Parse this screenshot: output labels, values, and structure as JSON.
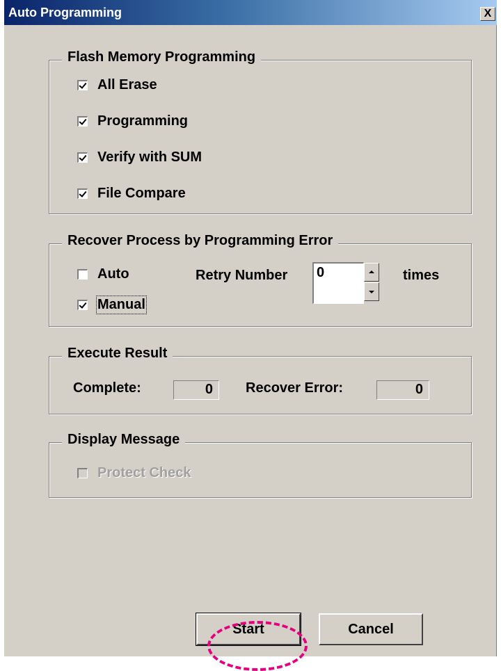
{
  "window": {
    "title": "Auto Programming",
    "close_label": "X"
  },
  "flash_group": {
    "title": "Flash Memory Programming",
    "items": [
      {
        "label": "All Erase",
        "checked": true
      },
      {
        "label": "Programming",
        "checked": true
      },
      {
        "label": "Verify with SUM",
        "checked": true
      },
      {
        "label": "File Compare",
        "checked": true
      }
    ]
  },
  "recover_group": {
    "title": "Recover Process by Programming Error",
    "auto": {
      "label": "Auto",
      "checked": false
    },
    "manual": {
      "label": "Manual",
      "checked": true
    },
    "retry_label": "Retry Number",
    "retry_value": "0",
    "times_label": "times"
  },
  "result_group": {
    "title": "Execute Result",
    "complete_label": "Complete:",
    "complete_value": "0",
    "recover_error_label": "Recover Error:",
    "recover_error_value": "0"
  },
  "display_group": {
    "title": "Display Message",
    "protect": {
      "label": "Protect Check",
      "checked": false,
      "enabled": false
    }
  },
  "buttons": {
    "start": "Start",
    "cancel": "Cancel"
  },
  "colors": {
    "title_bar": "#0a246a",
    "dialog_face": "#d4d0c8",
    "highlight": "#e4007f"
  }
}
